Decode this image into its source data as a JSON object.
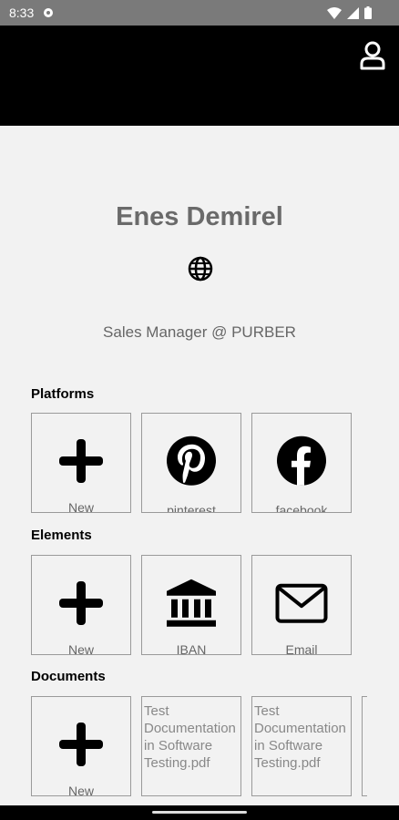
{
  "status_bar": {
    "time": "8:33",
    "icons": [
      "notification-icon",
      "wifi-icon",
      "signal-icon",
      "battery-icon"
    ]
  },
  "app_bar": {
    "background": "#000000",
    "action_icon": "profile-icon"
  },
  "profile": {
    "name": "Enes Demirel",
    "job": "Sales Manager @ PURBER",
    "globe_icon": "globe-icon"
  },
  "sections": {
    "platforms": {
      "title": "Platforms",
      "tiles": [
        {
          "label": "New",
          "icon": "plus-icon"
        },
        {
          "label": "pinterest",
          "icon": "pinterest-icon"
        },
        {
          "label": "facebook",
          "icon": "facebook-icon"
        }
      ]
    },
    "elements": {
      "title": "Elements",
      "tiles": [
        {
          "label": "New",
          "icon": "plus-icon"
        },
        {
          "label": "IBAN",
          "icon": "bank-icon"
        },
        {
          "label": "Email",
          "icon": "mail-icon"
        }
      ]
    },
    "documents": {
      "title": "Documents",
      "tiles": [
        {
          "label": "New",
          "icon": "plus-icon"
        },
        {
          "label": "Test Documentation in Software Testing.pdf"
        },
        {
          "label": "Test Documentation in Software Testing.pdf"
        }
      ]
    }
  }
}
